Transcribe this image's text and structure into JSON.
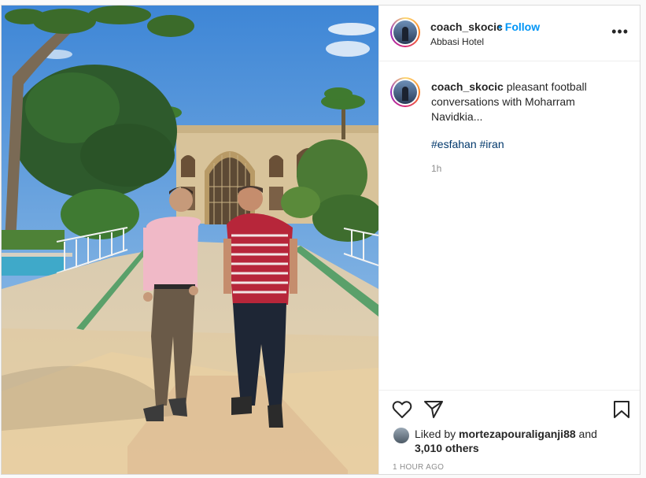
{
  "post": {
    "username": "coach_skocic",
    "follow_label": "Follow",
    "location": "Abbasi Hotel",
    "caption_text": "pleasant football conversations with Moharram Navidkia...",
    "hashtags": "#esfahan #iran",
    "caption_time": "1h",
    "likes": {
      "prefix": "Liked by",
      "user": "mortezapouraliganji88",
      "connector": "and",
      "others": "3,010 others"
    },
    "posted_ago": "1 HOUR AGO"
  },
  "icons": {
    "more": "more-options-icon",
    "like": "heart-icon",
    "share": "share-icon",
    "save": "bookmark-icon"
  },
  "colors": {
    "follow": "#0095f6",
    "hashtag": "#00376b",
    "muted": "#8e8e8e"
  }
}
